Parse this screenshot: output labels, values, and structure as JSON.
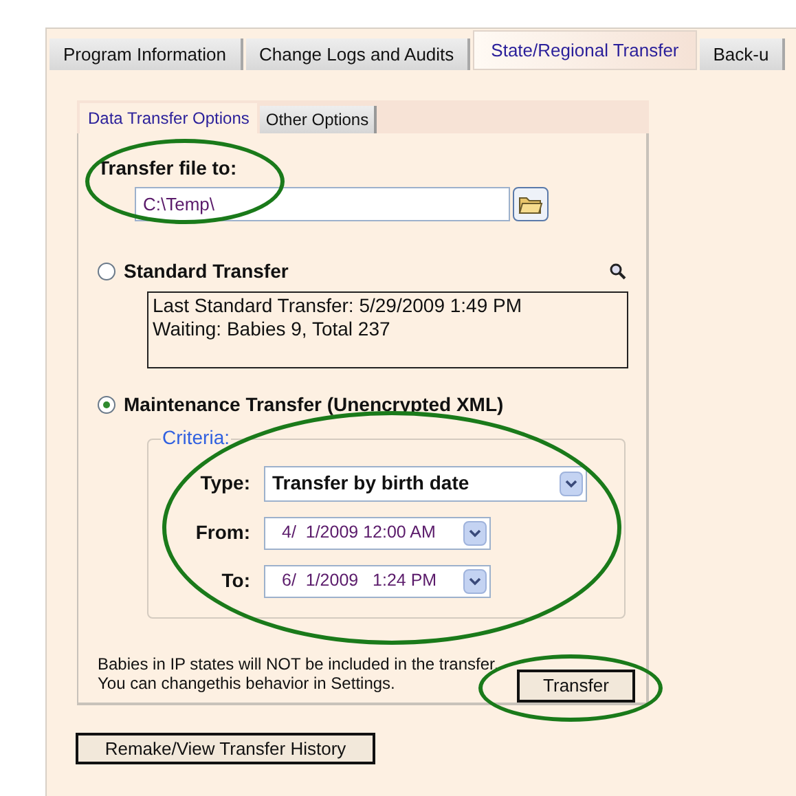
{
  "tabs": [
    {
      "label": "Program Information",
      "selected": false
    },
    {
      "label": "Change Logs and Audits",
      "selected": false
    },
    {
      "label": "State/Regional Transfer",
      "selected": true
    },
    {
      "label": "Back-u",
      "selected": false
    }
  ],
  "sub_tabs": [
    {
      "label": "Data Transfer Options",
      "selected": true
    },
    {
      "label": "Other Options",
      "selected": false
    }
  ],
  "transfer_file": {
    "label": "Transfer file to:",
    "value": "C:\\Temp\\",
    "highlighted": true
  },
  "standard": {
    "label": "Standard Transfer",
    "selected": false,
    "info": [
      "Last Standard Transfer: 5/29/2009 1:49 PM",
      "Waiting: Babies 9, Total 237"
    ]
  },
  "maintenance": {
    "label": "Maintenance Transfer (Unencrypted XML)",
    "selected": true
  },
  "criteria": {
    "legend": "Criteria:",
    "highlighted": true,
    "fields": [
      {
        "label": "Type:",
        "value": "Transfer by birth date",
        "kind": "select"
      },
      {
        "label": "From:",
        "value": "4/  1/2009 12:00 AM",
        "kind": "date"
      },
      {
        "label": "To:",
        "value": "6/  1/2009   1:24 PM",
        "kind": "date"
      }
    ]
  },
  "note": [
    "Babies in IP states will NOT be included in the transfer.",
    "You can changethis behavior in Settings."
  ],
  "transfer_button": {
    "label": "Transfer",
    "highlighted": true
  },
  "history_button": {
    "label": "Remake/View Transfer History"
  }
}
